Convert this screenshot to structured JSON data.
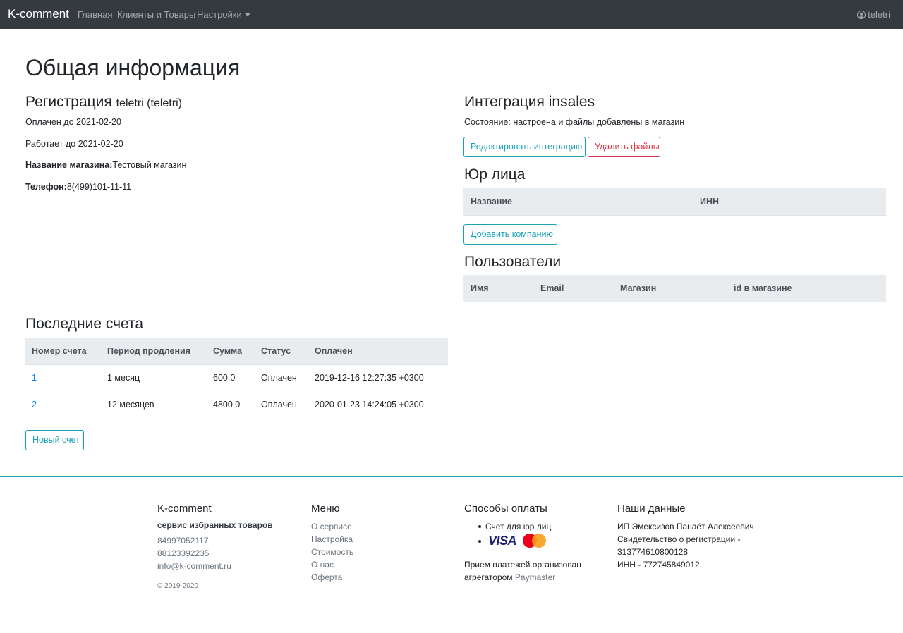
{
  "navbar": {
    "brand": "K-comment",
    "links": [
      "Главная",
      "Клиенты и Товары",
      "Настройки"
    ],
    "user": "teletri"
  },
  "page_title": "Общая информация",
  "registration": {
    "heading": "Регистрация",
    "heading_sub": "teletri (teletri)",
    "paid_until": "Оплачен до 2021-02-20",
    "works_until": "Работает до 2021-02-20",
    "shop_label": "Название магазина:",
    "shop_value": "Тестовый магазин",
    "phone_label": "Телефон:",
    "phone_value": "8(499)101-11-11"
  },
  "integration": {
    "heading": "Интеграция insales",
    "status": "Состояние: настроена и файлы добавлены в магазин",
    "edit_button": "Редактировать интеграцию",
    "delete_button": "Удалить файлы"
  },
  "legal": {
    "heading": "Юр лица",
    "columns": [
      "Название",
      "ИНН"
    ],
    "add_button": "Добавить компанию"
  },
  "users": {
    "heading": "Пользователи",
    "columns": [
      "Имя",
      "Email",
      "Магазин",
      "id в магазине"
    ]
  },
  "invoices": {
    "heading": "Последние счета",
    "columns": [
      "Номер счета",
      "Период продления",
      "Сумма",
      "Статус",
      "Оплачен"
    ],
    "rows": [
      [
        "1",
        "1 месяц",
        "600.0",
        "Оплачен",
        "2019-12-16 12:27:35 +0300"
      ],
      [
        "2",
        "12 месяцев",
        "4800.0",
        "Оплачен",
        "2020-01-23 14:24:05 +0300"
      ]
    ],
    "new_button": "Новый счет"
  },
  "footer": {
    "brand": {
      "heading": "K-comment",
      "tagline": "сервис избранных товаров",
      "phone1": "84997052117",
      "phone2": "88123392235",
      "email": "info@k-comment.ru",
      "copyright": "© 2019-2020"
    },
    "menu": {
      "heading": "Меню",
      "items": [
        "О сервисе",
        "Настройка",
        "Стоимость",
        "О нас",
        "Оферта"
      ]
    },
    "payment": {
      "heading": "Способы оплаты",
      "item1": "Счет для юр лиц",
      "visa_text": "VISA",
      "note_line1": "Прием платежей организован",
      "note_line2_prefix": "агрегатором",
      "note_link": "Paymaster"
    },
    "our_data": {
      "heading": "Наши данные",
      "line1": "ИП Эмексизов Панаёт Алексеевич",
      "line2": "Свидетельство о регистрации -",
      "line3": "313774610800128",
      "line4": "ИНН - 772745849012"
    }
  },
  "colors": {
    "navbar_bg": "#343a40",
    "primary": "#007bff",
    "info": "#17a2b8",
    "danger": "#dc3545",
    "table_head_bg": "#e9ecef"
  }
}
